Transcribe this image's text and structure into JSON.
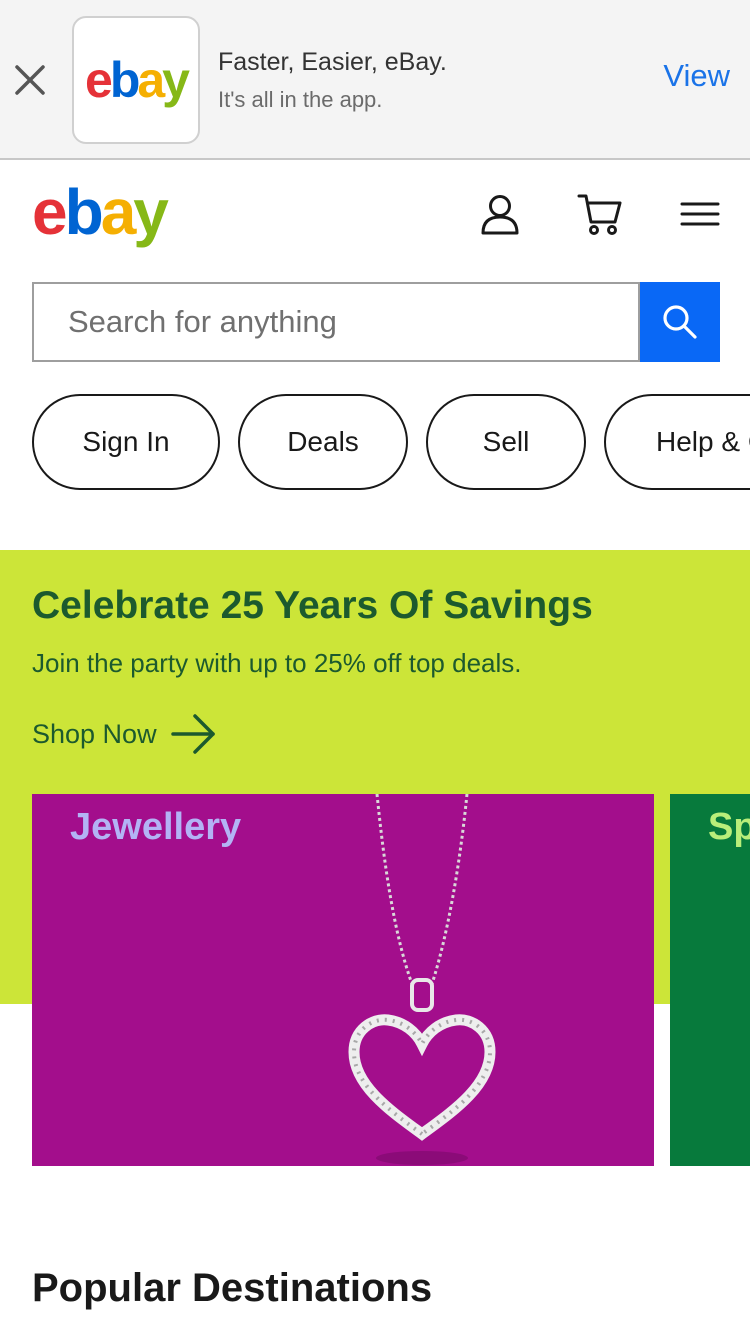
{
  "app_banner": {
    "title": "Faster, Easier, eBay.",
    "subtitle": "It's all in the app.",
    "view_label": "View",
    "logo_letters": [
      "e",
      "b",
      "a",
      "y"
    ]
  },
  "header": {
    "logo_letters": [
      "e",
      "b",
      "a",
      "y"
    ]
  },
  "search": {
    "placeholder": "Search for anything",
    "value": ""
  },
  "quick_links": {
    "sign_in": "Sign In",
    "deals": "Deals",
    "sell": "Sell",
    "help": "Help & Contact"
  },
  "promo": {
    "title": "Celebrate 25 Years Of Savings",
    "subtitle": "Join the party with up to 25% off top deals.",
    "link_label": "Shop Now"
  },
  "cards": [
    {
      "label": "Jewellery"
    },
    {
      "label": "Sports"
    }
  ],
  "sections": {
    "popular_destinations": "Popular Destinations"
  },
  "icons": {
    "close": "close-icon",
    "account": "account-icon",
    "cart": "cart-icon",
    "menu": "menu-icon",
    "search": "search-icon",
    "arrow": "arrow-right-icon"
  },
  "colors": {
    "search_button": "#0968f6",
    "promo_background": "#cce538",
    "promo_text": "#1c5a2e",
    "jewellery_card": "#a30e8c",
    "sports_card": "#077a3c",
    "view_link": "#1a73e8",
    "logo_e": "#e53238",
    "logo_b": "#0064d2",
    "logo_a": "#f5af02",
    "logo_y": "#86b817"
  }
}
